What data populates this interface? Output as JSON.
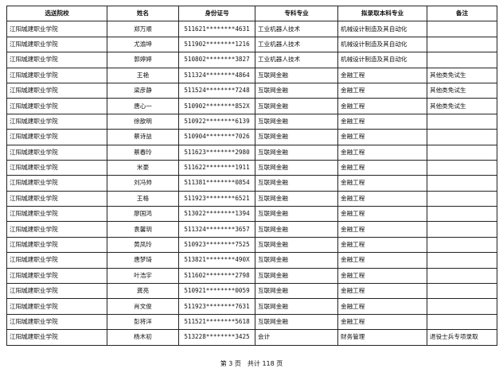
{
  "table": {
    "headers": [
      "选送院校",
      "姓名",
      "身份证号",
      "专科专业",
      "拟录取本科专业",
      "备注"
    ],
    "rows": [
      [
        "江阳城建职业学院",
        "郑万顺",
        "511621********4631",
        "工业机器人技术",
        "机械设计制造及其自动化",
        ""
      ],
      [
        "江阳城建职业学院",
        "尤渝坤",
        "511902********1216",
        "工业机器人技术",
        "机械设计制造及其自动化",
        ""
      ],
      [
        "江阳城建职业学院",
        "郭婷婷",
        "510802********3827",
        "工业机器人技术",
        "机械设计制造及其自动化",
        ""
      ],
      [
        "江阳城建职业学院",
        "王艳",
        "511324********4864",
        "互联网金融",
        "金融工程",
        "其他类免试生"
      ],
      [
        "江阳城建职业学院",
        "梁彦静",
        "511524********7248",
        "互联网金融",
        "金融工程",
        "其他类免试生"
      ],
      [
        "江阳城建职业学院",
        "唐心一",
        "510902********852X",
        "互联网金融",
        "金融工程",
        "其他类免试生"
      ],
      [
        "江阳城建职业学院",
        "徐歆明",
        "510922********6139",
        "互联网金融",
        "金融工程",
        ""
      ],
      [
        "江阳城建职业学院",
        "蔡诗益",
        "510904********7026",
        "互联网金融",
        "金融工程",
        ""
      ],
      [
        "江阳城建职业学院",
        "蔡春玲",
        "511623********2980",
        "互联网金融",
        "金融工程",
        ""
      ],
      [
        "江阳城建职业学院",
        "米豪",
        "511622********1911",
        "互联网金融",
        "金融工程",
        ""
      ],
      [
        "江阳城建职业学院",
        "刘冯帅",
        "511381********0854",
        "互联网金融",
        "金融工程",
        ""
      ],
      [
        "江阳城建职业学院",
        "王格",
        "511923********6521",
        "互联网金融",
        "金融工程",
        ""
      ],
      [
        "江阳城建职业学院",
        "廖国鸿",
        "513022********1394",
        "互联网金融",
        "金融工程",
        ""
      ],
      [
        "江阳城建职业学院",
        "袁馨玥",
        "511324********3657",
        "互联网金融",
        "金融工程",
        ""
      ],
      [
        "江阳城建职业学院",
        "黄凤玲",
        "510923********7525",
        "互联网金融",
        "金融工程",
        ""
      ],
      [
        "江阳城建职业学院",
        "唐梦琦",
        "513821********490X",
        "互联网金融",
        "金融工程",
        ""
      ],
      [
        "江阳城建职业学院",
        "叶浩宇",
        "511602********2798",
        "互联网金融",
        "金融工程",
        ""
      ],
      [
        "江阳城建职业学院",
        "龚亮",
        "510921********0059",
        "互联网金融",
        "金融工程",
        ""
      ],
      [
        "江阳城建职业学院",
        "肖文俊",
        "511923********7631",
        "互联网金融",
        "金融工程",
        ""
      ],
      [
        "江阳城建职业学院",
        "彭将洋",
        "511521********5618",
        "互联网金融",
        "金融工程",
        ""
      ],
      [
        "江阳城建职业学院",
        "杨木初",
        "513228********3425",
        "会计",
        "财务管理",
        "退役士兵专项录取"
      ]
    ]
  },
  "footer": {
    "page_label": "第 3 页　共计 118 页"
  }
}
